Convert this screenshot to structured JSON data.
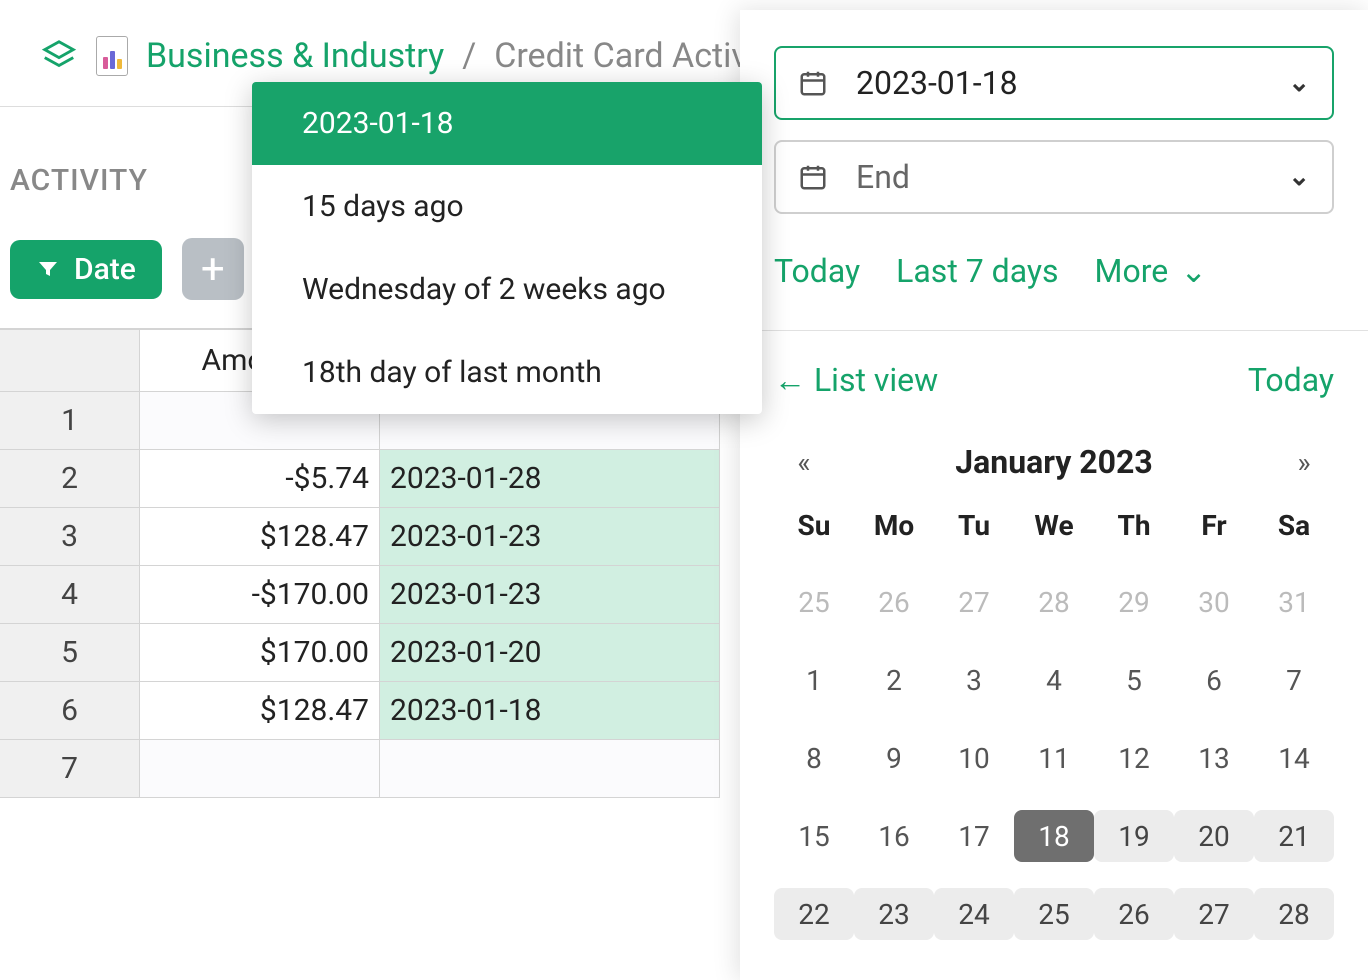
{
  "breadcrumb": {
    "parent": "Business & Industry",
    "separator": "/",
    "current": "Credit Card Activity"
  },
  "section_label": "ACTIVITY",
  "filter": {
    "date_label": "Date"
  },
  "table": {
    "headers": {
      "amount": "Amount"
    },
    "rows": [
      {
        "idx": "1",
        "amount": "",
        "date": ""
      },
      {
        "idx": "2",
        "amount": "-$5.74",
        "date": "2023-01-28"
      },
      {
        "idx": "3",
        "amount": "$128.47",
        "date": "2023-01-23"
      },
      {
        "idx": "4",
        "amount": "-$170.00",
        "date": "2023-01-23"
      },
      {
        "idx": "5",
        "amount": "$170.00",
        "date": "2023-01-20"
      },
      {
        "idx": "6",
        "amount": "$128.47",
        "date": "2023-01-18"
      },
      {
        "idx": "7",
        "amount": "",
        "date": ""
      }
    ]
  },
  "suggest": {
    "options": [
      "2023-01-18",
      "15 days ago",
      "Wednesday of 2 weeks ago",
      "18th day of last month"
    ],
    "selected_index": 0
  },
  "panel": {
    "start_value": "2023-01-18",
    "end_placeholder": "End",
    "quick": {
      "today": "Today",
      "last7": "Last 7 days",
      "more": "More"
    },
    "list_view": "←  List view",
    "today_link": "Today"
  },
  "calendar": {
    "title": "January 2023",
    "dow": [
      "Su",
      "Mo",
      "Tu",
      "We",
      "Th",
      "Fr",
      "Sa"
    ],
    "days": [
      {
        "n": "25",
        "o": true
      },
      {
        "n": "26",
        "o": true
      },
      {
        "n": "27",
        "o": true
      },
      {
        "n": "28",
        "o": true
      },
      {
        "n": "29",
        "o": true
      },
      {
        "n": "30",
        "o": true
      },
      {
        "n": "31",
        "o": true
      },
      {
        "n": "1"
      },
      {
        "n": "2"
      },
      {
        "n": "3"
      },
      {
        "n": "4"
      },
      {
        "n": "5"
      },
      {
        "n": "6"
      },
      {
        "n": "7"
      },
      {
        "n": "8"
      },
      {
        "n": "9"
      },
      {
        "n": "10"
      },
      {
        "n": "11"
      },
      {
        "n": "12"
      },
      {
        "n": "13"
      },
      {
        "n": "14"
      },
      {
        "n": "15"
      },
      {
        "n": "16"
      },
      {
        "n": "17"
      },
      {
        "n": "18",
        "sel": true
      },
      {
        "n": "19",
        "r": true
      },
      {
        "n": "20",
        "r": true
      },
      {
        "n": "21",
        "r": true
      },
      {
        "n": "22",
        "r": true
      },
      {
        "n": "23",
        "r": true
      },
      {
        "n": "24",
        "r": true
      },
      {
        "n": "25",
        "r": true
      },
      {
        "n": "26",
        "r": true
      },
      {
        "n": "27",
        "r": true
      },
      {
        "n": "28",
        "r": true
      }
    ]
  }
}
